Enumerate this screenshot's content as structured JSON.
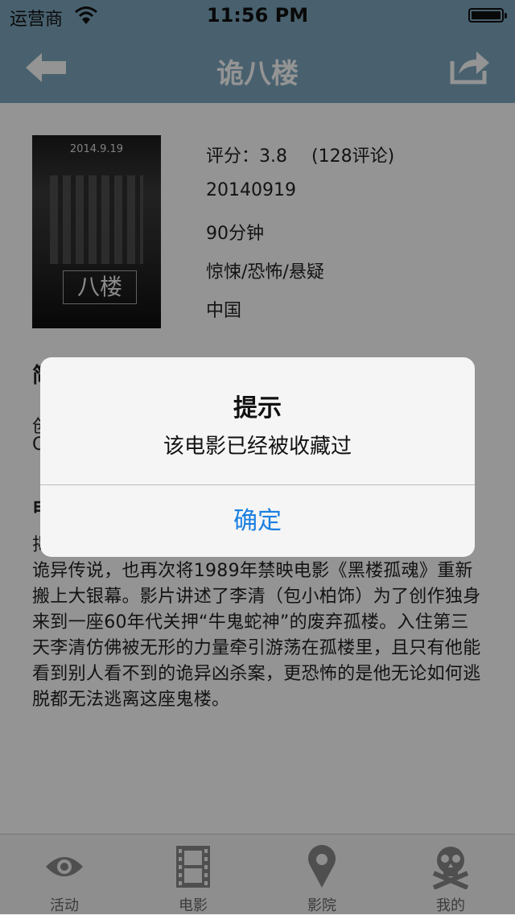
{
  "status": {
    "carrier": "运营商",
    "time": "11:56 PM"
  },
  "nav": {
    "title": "诡八楼"
  },
  "movie": {
    "poster": {
      "date_text": "2014.9.19",
      "logo_text": "八楼"
    },
    "rating_label": "评分：3.8",
    "review_count": "(128评论)",
    "release_date": "20140919",
    "duration": "90分钟",
    "genre": "惊悚/恐怖/悬疑",
    "country": "中国",
    "section_head_partial": "简",
    "director_partial": "创",
    "cast_partial": "C",
    "plot_head_partial": "电",
    "synopsis": "揭开京四大鬼宅”之一的北京白塔寺福绥境胡同鬼八楼的诡异传说，也再次将1989年禁映电影《黑楼孤魂》重新搬上大银幕。影片讲述了李清（包小柏饰）为了创作独身来到一座60年代关押“牛鬼蛇神”的废弃孤楼。入住第三天李清仿佛被无形的力量牵引游荡在孤楼里，且只有他能看到别人看不到的诡异凶杀案，更恐怖的是他无论如何逃脱都无法逃离这座鬼楼。"
  },
  "tabs": [
    {
      "label": "活动",
      "icon": "eye-icon"
    },
    {
      "label": "电影",
      "icon": "film-icon"
    },
    {
      "label": "影院",
      "icon": "location-pin-icon"
    },
    {
      "label": "我的",
      "icon": "skull-icon"
    }
  ],
  "alert": {
    "title": "提示",
    "message": "该电影已经被收藏过",
    "confirm": "确定"
  },
  "colors": {
    "nav": "#7fa7be",
    "alert_button": "#1a7fe0"
  }
}
